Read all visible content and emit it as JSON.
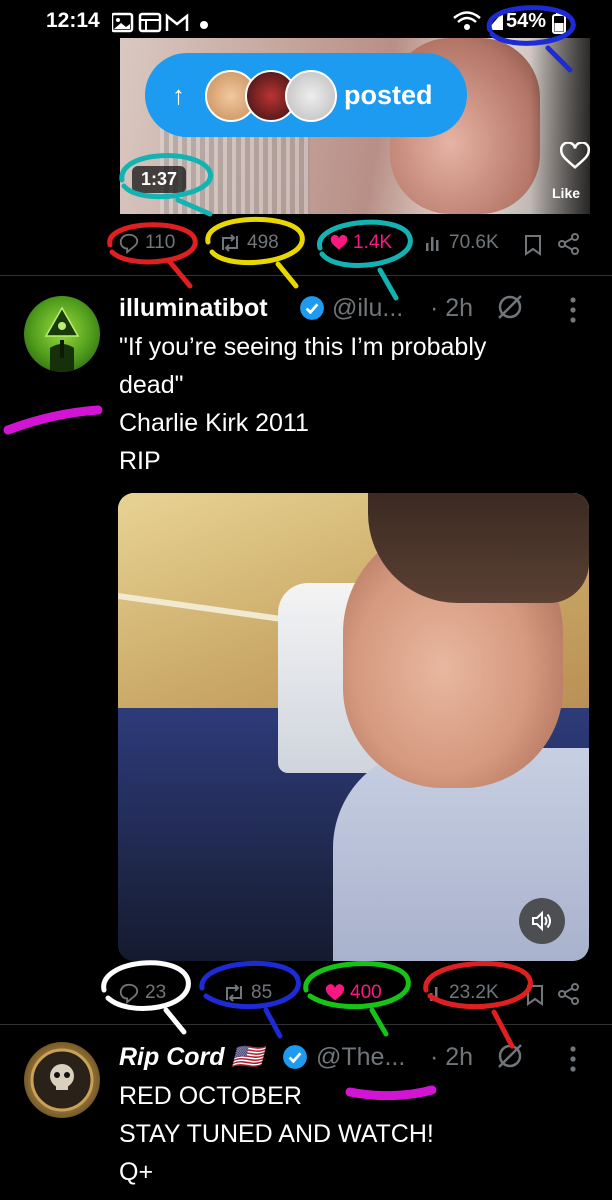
{
  "status_bar": {
    "time": "12:14",
    "battery": "54%"
  },
  "top_video": {
    "pill_arrow": "↑",
    "pill_label": "posted",
    "duration": "1:37",
    "like_label": "Like"
  },
  "top_actions": {
    "replies": "110",
    "reposts": "498",
    "likes": "1.4K",
    "views": "70.6K"
  },
  "tweet1": {
    "name": "illuminatibot",
    "handle": "@ilu...",
    "time": "· 2h",
    "lines": [
      "\"If you’re seeing this I’m probably",
      "dead\"",
      "Charlie Kirk 2011",
      "RIP"
    ],
    "actions": {
      "replies": "23",
      "reposts": "85",
      "likes": "400",
      "views": "23.2K"
    }
  },
  "tweet2": {
    "name": "Rip Cord 🇺🇸",
    "handle": "@The...",
    "time": "· 2h",
    "lines": [
      "RED OCTOBER",
      "STAY TUNED AND WATCH!",
      "Q+"
    ]
  },
  "colors": {
    "accent": "#1d9bf0",
    "like_pink": "#f91880",
    "muted": "#71767b"
  }
}
